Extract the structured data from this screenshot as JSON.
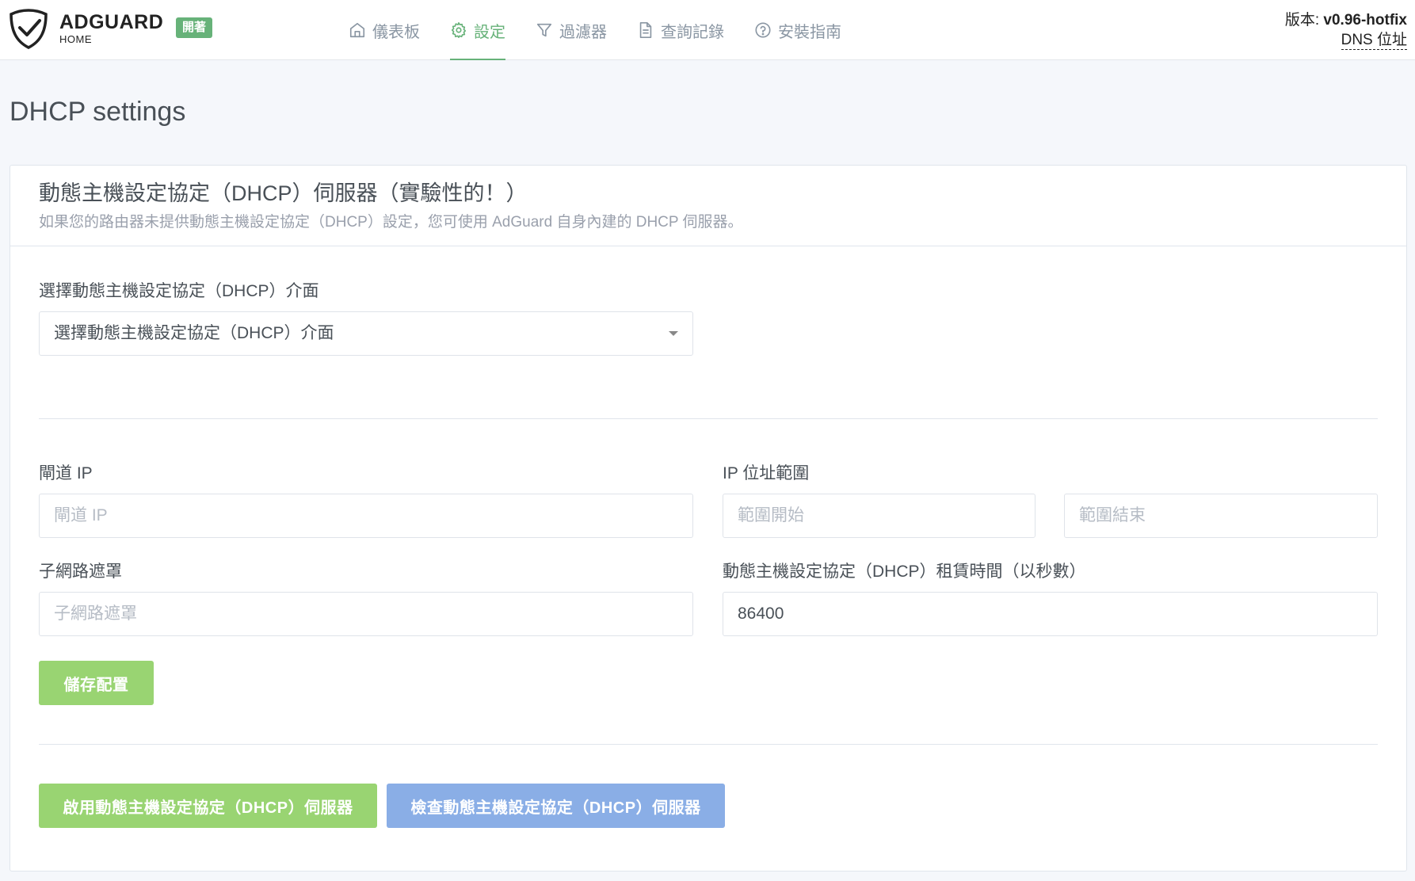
{
  "header": {
    "brand_name": "ADGUARD",
    "brand_sub": "HOME",
    "badge": "開著",
    "nav": [
      {
        "label": "儀表板",
        "icon": "home-icon"
      },
      {
        "label": "設定",
        "icon": "gear-icon"
      },
      {
        "label": "過濾器",
        "icon": "filter-icon"
      },
      {
        "label": "查詢記錄",
        "icon": "document-icon"
      },
      {
        "label": "安裝指南",
        "icon": "help-circle-icon"
      }
    ],
    "active_nav": 1,
    "version_label": "版本: ",
    "version_value": "v0.96-hotfix",
    "dns_link": "DNS 位址"
  },
  "page": {
    "title": "DHCP settings"
  },
  "card": {
    "title": "動態主機設定協定（DHCP）伺服器（實驗性的！）",
    "subtitle": "如果您的路由器未提供動態主機設定協定（DHCP）設定，您可使用 AdGuard 自身內建的 DHCP 伺服器。",
    "interface_label": "選擇動態主機設定協定（DHCP）介面",
    "interface_selected": "選擇動態主機設定協定（DHCP）介面",
    "gateway_label": "閘道 IP",
    "gateway_placeholder": "閘道 IP",
    "range_label": "IP 位址範圍",
    "range_start_placeholder": "範圍開始",
    "range_end_placeholder": "範圍結束",
    "subnet_label": "子網路遮罩",
    "subnet_placeholder": "子網路遮罩",
    "lease_label": "動態主機設定協定（DHCP）租賃時間（以秒數）",
    "lease_value": "86400",
    "save_button": "儲存配置",
    "enable_button": "啟用動態主機設定協定（DHCP）伺服器",
    "check_button": "檢查動態主機設定協定（DHCP）伺服器"
  },
  "colors": {
    "accent": "#67b279",
    "button_green": "#99d472",
    "button_blue": "#8aaee6"
  }
}
